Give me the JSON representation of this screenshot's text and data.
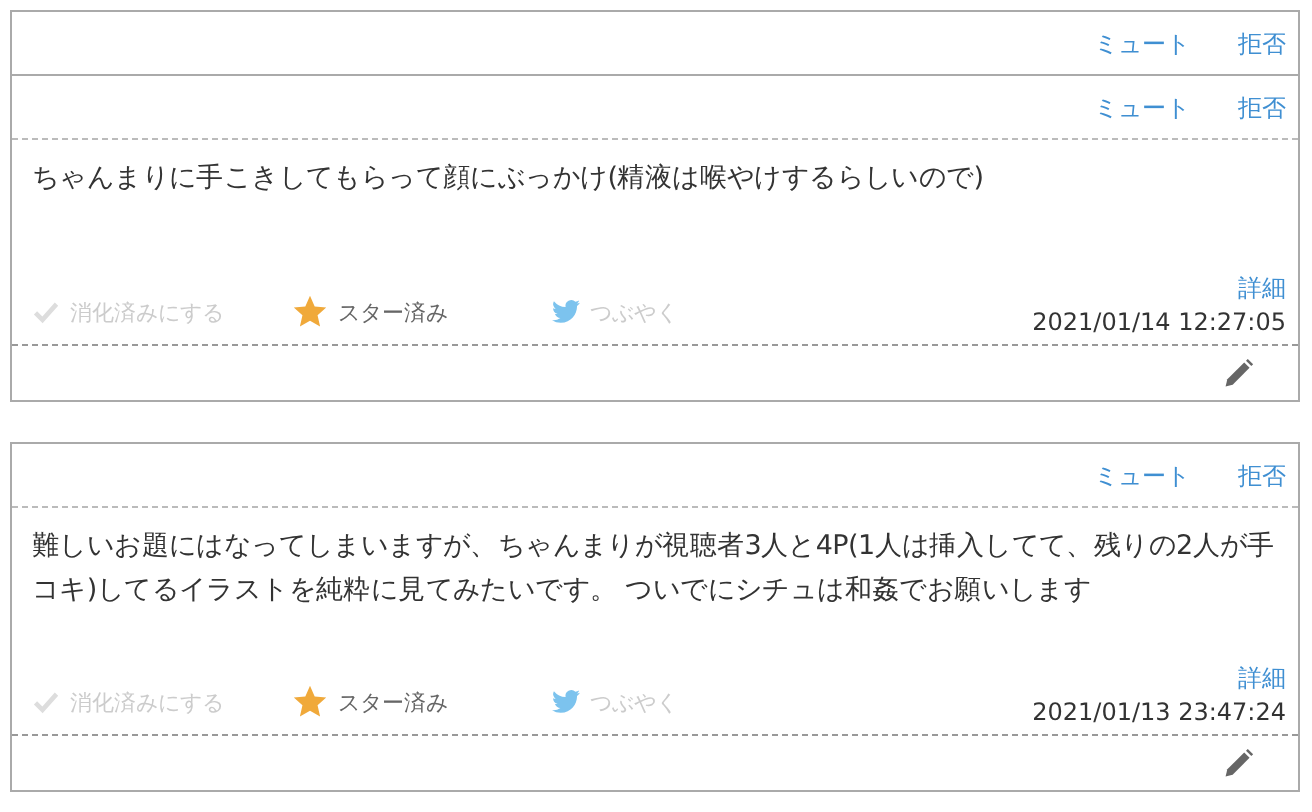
{
  "cards": [
    {
      "mute": "ミュート",
      "reject": "拒否"
    },
    {
      "mute": "ミュート",
      "reject": "拒否",
      "message": "ちゃんまりに手こきしてもらって顔にぶっかけ(精液は喉やけするらしいので)",
      "done_label": "消化済みにする",
      "done": false,
      "star_label": "スター済み",
      "starred": true,
      "tweet_label": "つぶやく",
      "detail": "詳細",
      "date": "2021/01/14 12:27:05"
    },
    {
      "mute": "ミュート",
      "reject": "拒否",
      "message": "難しいお題にはなってしまいますが、ちゃんまりが視聴者3人と4P(1人は挿入してて、残りの2人が手コキ)してるイラストを純粋に見てみたいです。 ついでにシチュは和姦でお願いします",
      "done_label": "消化済みにする",
      "done": false,
      "star_label": "スター済み",
      "starred": true,
      "tweet_label": "つぶやく",
      "detail": "詳細",
      "date": "2021/01/13 23:47:24"
    }
  ]
}
